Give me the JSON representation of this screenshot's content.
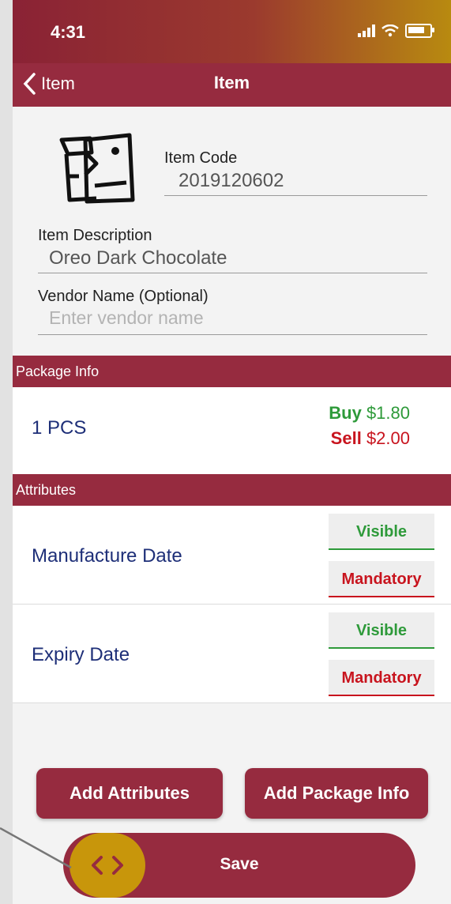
{
  "status_bar": {
    "time": "4:31"
  },
  "nav": {
    "back_label": "Item",
    "title": "Item"
  },
  "item": {
    "code_label": "Item Code",
    "code_value": "2019120602",
    "description_label": "Item Description",
    "description_value": "Oreo Dark Chocolate",
    "vendor_label": "Vendor Name (Optional)",
    "vendor_placeholder": "Enter vendor name",
    "vendor_value": ""
  },
  "package_info": {
    "header": "Package Info",
    "unit": "1 PCS",
    "buy_label": "Buy",
    "buy_value": "$1.80",
    "sell_label": "Sell",
    "sell_value": "$2.00"
  },
  "attributes": {
    "header": "Attributes",
    "items": [
      {
        "name": "Manufacture Date",
        "visible_label": "Visible",
        "mandatory_label": "Mandatory"
      },
      {
        "name": "Expiry Date",
        "visible_label": "Visible",
        "mandatory_label": "Mandatory"
      }
    ]
  },
  "actions": {
    "add_attributes": "Add Attributes",
    "add_package_info": "Add Package Info",
    "save": "Save"
  },
  "colors": {
    "primary": "#962b3f",
    "buy": "#2e9a3a",
    "sell": "#c8141e",
    "label_blue": "#1e2f78",
    "toggle": "#c8960b"
  },
  "icons": [
    "back-chevron-icon",
    "item-image-icon",
    "signal-icon",
    "wifi-icon",
    "battery-icon",
    "code-toggle-icon"
  ]
}
